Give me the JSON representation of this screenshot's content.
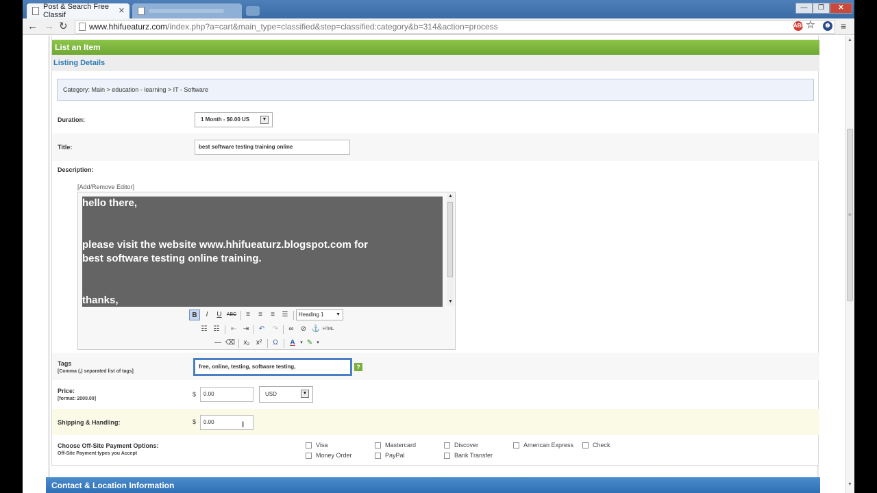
{
  "browser": {
    "active_tab_title": "Post & Search Free Classif",
    "tab_close": "✕",
    "url_host": "www.hhifueaturz.com",
    "url_path": "/index.php?a=cart&main_type=classified&step=classified:category&b=314&action=process",
    "window_controls": {
      "minimize": "—",
      "maximize": "❐",
      "close": "✕"
    }
  },
  "form": {
    "header": "List an Item",
    "section": "Listing Details",
    "category": "Category: Main > education - learning > IT - Software",
    "duration": {
      "label": "Duration:",
      "value": "1 Month - $0.00 US"
    },
    "title": {
      "label": "Title:",
      "value": "best software testing training online"
    },
    "description": {
      "label": "Description:",
      "toggle": "[Add/Remove Editor]",
      "lines": [
        "hello there,",
        "please visit the website www.hhifueaturz.blogspot.com for",
        "best software testing online training.",
        "thanks,"
      ],
      "format": "Heading 1"
    },
    "tags": {
      "label": "Tags",
      "hint": "[Comma (,) separated list of tags]",
      "value": "free, online, testing, software testing,"
    },
    "price": {
      "label": "Price:",
      "hint": "[format: 2000.00]",
      "currency_symbol": "$",
      "value": "0.00",
      "currency": "USD"
    },
    "shipping": {
      "label": "Shipping & Handling:",
      "currency_symbol": "$",
      "value": "0.00"
    },
    "payment": {
      "label": "Choose Off-Site Payment Options:",
      "hint": "Off-Site Payment types you Accept",
      "options": [
        "Visa",
        "Mastercard",
        "Discover",
        "American Express",
        "Check",
        "Money Order",
        "PayPal",
        "Bank Transfer"
      ]
    },
    "contact_header": "Contact & Location Information"
  }
}
